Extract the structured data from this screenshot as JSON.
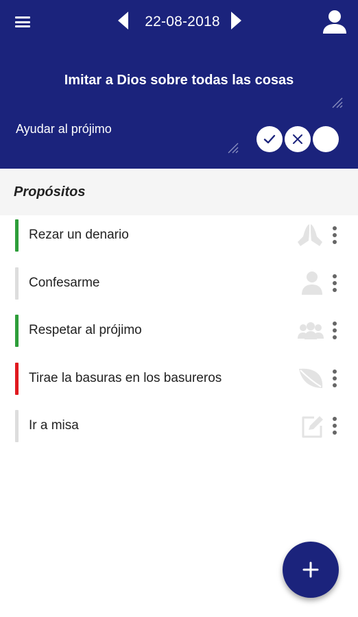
{
  "header": {
    "date": "22-08-2018",
    "title": "Imitar a Dios sobre todas las cosas",
    "goal": "Ayudar al prójimo",
    "status_buttons": [
      "check-icon",
      "cross-icon",
      "empty-circle"
    ],
    "background_color": "#1b237c"
  },
  "section": {
    "title": "Propósitos"
  },
  "items": [
    {
      "label": "Rezar un denario",
      "status_color": "#2e9e3a",
      "icon": "praying-hands-icon"
    },
    {
      "label": "Confesarme",
      "status_color": "#dddddd",
      "icon": "person-icon"
    },
    {
      "label": "Respetar al prójimo",
      "status_color": "#2e9e3a",
      "icon": "group-icon"
    },
    {
      "label": "Tirae la basuras en los basureros",
      "status_color": "#e0191f",
      "icon": "leaf-icon"
    },
    {
      "label": "Ir a misa",
      "status_color": "#dddddd",
      "icon": "edit-icon"
    }
  ],
  "fab": {
    "icon": "plus-icon"
  }
}
